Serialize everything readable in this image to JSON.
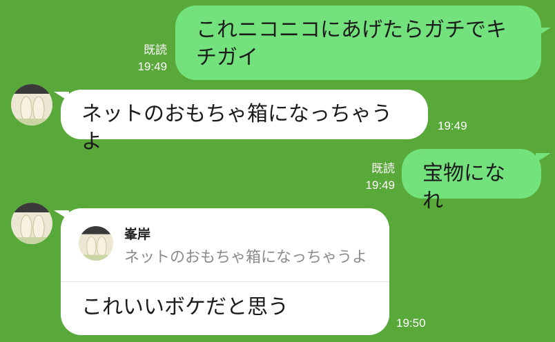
{
  "messages": [
    {
      "side": "outgoing",
      "text": "これニコニコにあげたらガチでキチガイ",
      "read": "既読",
      "time": "19:49"
    },
    {
      "side": "incoming",
      "text": "ネットのおもちゃ箱になっちゃうよ",
      "time": "19:49"
    },
    {
      "side": "outgoing",
      "text": "宝物になれ",
      "read": "既読",
      "time": "19:49"
    },
    {
      "side": "incoming",
      "text": "これいいボケだと思う",
      "time": "19:50",
      "reply": {
        "author": "峯岸",
        "text": "ネットのおもちゃ箱になっちゃうよ"
      }
    }
  ],
  "colors": {
    "background": "#58a83a",
    "outgoing_bubble": "#74e27c",
    "incoming_bubble": "#ffffff"
  },
  "icons": {
    "avatar": "avatar-two-dogs"
  }
}
